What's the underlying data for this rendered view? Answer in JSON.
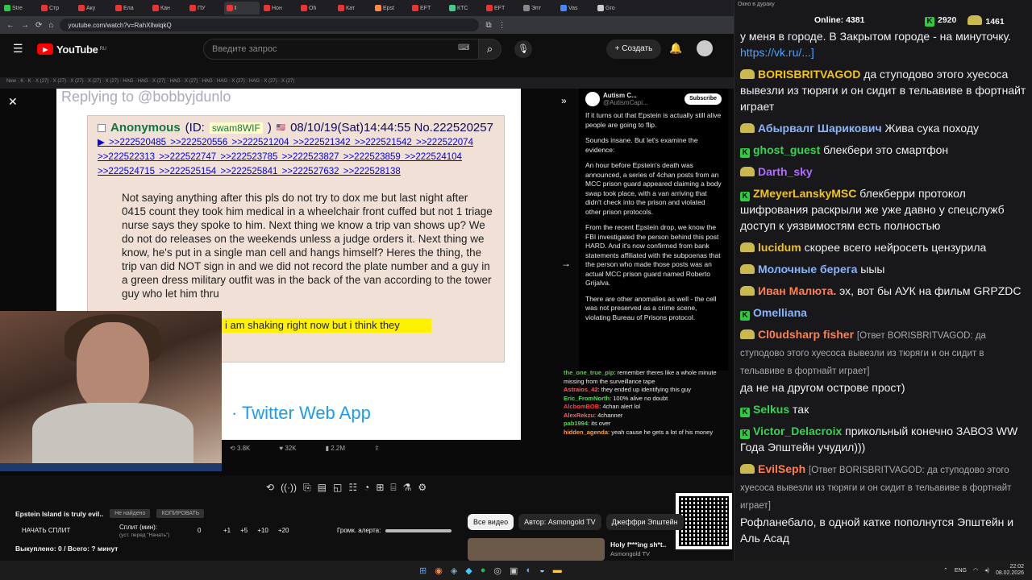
{
  "browser": {
    "tabs": [
      "Stre",
      "Стр",
      "Аку",
      "Ела",
      "Кан",
      "ПУ",
      "I",
      "Нон",
      "Оh",
      "Кат",
      "Epst",
      "EFT",
      "КТС",
      "EFT",
      "Эпт",
      "Vas",
      "Gro"
    ],
    "url": "youtube.com/watch?v=RahXIlwiqkQ",
    "window_controls": [
      "—",
      "▢",
      "✕"
    ]
  },
  "youtube": {
    "logo": "YouTube",
    "region": "RU",
    "search_placeholder": "Введите запрос",
    "create_label": "Создать",
    "chips": [
      "Все видео",
      "Автор: Asmongold TV",
      "Джеффри Эпштейн"
    ],
    "recommended": {
      "title": "Holy f***ing sh*t..",
      "channel": "Asmongold TV"
    }
  },
  "video": {
    "inner_tabs": "New · K · K · Х (27) · Х (27) · Х (27) · Х (27) · Х (27) · HAG · HAG · Х (27) · HAG · Х (27) · HAG · HAG · Х (27) · HAG · Х (27) · Х (27)",
    "tweet_heading": "Replying to @bobbyjdunlo",
    "chan_post": {
      "name": "Anonymous",
      "id_label": "(ID:",
      "id": "swam8WIF",
      "id_close": ")",
      "datetime": "08/10/19(Sat)14:44:55 No.222520257",
      "replies_1": "▶ >>222520485 >>222520556 >>222521204 >>222521342 >>222521542 >>222522074",
      "replies_2": ">>222522313 >>222522747 >>222523785 >>222523827 >>222523859 >>222524104",
      "replies_3": ">>222524715 >>222525154 >>222525841 >>222527632 >>222528138",
      "body": "Not saying anything after this pls do not try to dox me but last night after 0415 count they took him medical in a wheelchair front cuffed but not 1 triage nurse says they spoke to him. Next thing we know a trip van shows up? We do not do releases on the weekends unless a judge orders it. Next thing we know, he's put in a single man cell and hangs himself? Heres the thing, the trip van did NOT sign in and we did not record the plate number and a guy in a green dress military outfit was in the back of the van according to the tower guy who let him thru",
      "highlight": "i am shaking right now but i think they"
    },
    "twitter_app": "Twitter Web App",
    "tweet_stats": [
      "3.8K",
      "32K",
      "2.2M"
    ],
    "side": {
      "account": "Autism C...",
      "handle": "@AutismCapi...",
      "subscribe": "Subscribe",
      "paragraphs": [
        "If it turns out that Epstein is actually still alive people are going to flip.",
        "Sounds insane. But let's examine the evidence:",
        "An hour before Epstein's death was announced, a series of 4chan posts from an MCC prison guard appeared claiming a body swap took place, with a van arriving that didn't check into the prison and violated other prison protocols.",
        "From the recent Epstein drop, we know the FBI investigated the person behind this post HARD. And it's now confirmed from bank statements affiliated with the subpoenas that the person who made those posts was an actual MCC prison guard named Roberto Grijalva.",
        "There are other anomalies as well - the cell was not preserved as a crime scene, violating Bureau of Prisons protocol."
      ]
    },
    "overlay_chat": [
      {
        "name": "the_one_true_pip",
        "color": "#6bbf59",
        "text": "remember theres like a whole minute missing from the surveillance tape"
      },
      {
        "name": "Astraios_42",
        "color": "#ff5a5a",
        "text": "they ended up identifying this guy"
      },
      {
        "name": "Eric_FromNorth",
        "color": "#5ad35a",
        "text": "100% alive no doubt"
      },
      {
        "name": "AlcbomBOB",
        "color": "#ff4040",
        "text": "4chan alert lol"
      },
      {
        "name": "AlexRekzu",
        "color": "#ff6060",
        "text": "4channer"
      },
      {
        "name": "pab1994",
        "color": "#5ad35a",
        "text": "its over"
      },
      {
        "name": "hidden_agenda",
        "color": "#ff9f40",
        "text": "yeah cause he gets a lot of his money"
      }
    ]
  },
  "splits": {
    "title": "Epstein Island is truly evil..",
    "not_found": "Не найдено",
    "copy": "КОПИРОВАТЬ",
    "start": "НАЧАТЬ СПЛИТ",
    "split_label": "Сплит (мин):",
    "split_hint": "(уст. перед \"Начать\")",
    "split_value": "0",
    "increments": [
      "+1",
      "+5",
      "+10",
      "+20"
    ],
    "volume_label": "Громк. алерта:",
    "bought": "Выкуплено: 0 / Всего: ? минут"
  },
  "stream_chat": {
    "title": "Окно в дураку",
    "online_label": "Online:",
    "online_count": "4381",
    "points_green": "2920",
    "points_gold": "1461",
    "messages": [
      {
        "name": "",
        "color": "#efeff1",
        "text": "у меня в городе. В Закрытом городе - на минуточку.",
        "link": "https://vk.ru/...]"
      },
      {
        "name": "BORISBRITVAGOD",
        "color": "#f0c419",
        "text": "да ступодово этого хуесоса вывезли из тюряги и он сидит в тельавиве в фортнайт играет"
      },
      {
        "name": "Абырвалг Шарикович",
        "color": "#8ab4f8",
        "text": "Жива сука походу"
      },
      {
        "name": "ghost_guest",
        "color": "#39d353",
        "text": "блекбери это смартфон"
      },
      {
        "name": "Darth_sky",
        "color": "#b26bff",
        "text": ""
      },
      {
        "name": "ZMeyerLanskyMSC",
        "color": "#f0c419",
        "text": "блекберри протокол шифрования раскрыли же уже давно у спецслужб доступ к уязвимостям есть полностью"
      },
      {
        "name": "lucidum",
        "color": "#f0c419",
        "text": "скорее всего нейросеть цензурила"
      },
      {
        "name": "Молочные берега",
        "color": "#8ab4f8",
        "text": "ыыы"
      },
      {
        "name": "Иван Малюта.",
        "color": "#ff7f50",
        "text": "эх, вот бы АУК на фильм GRPZDC"
      },
      {
        "name": "Omelliana",
        "color": "#8ab4f8",
        "text": ""
      },
      {
        "name": "Cl0udsharp fisher",
        "color": "#ff7f50",
        "reply": "[Ответ BORISBRITVAGOD: да ступодово этого хуесоса вывезли из тюряги и он сидит в тельавиве в фортнайт играет]",
        "text": "да не на другом острове прост)"
      },
      {
        "name": "Selkus",
        "color": "#39d353",
        "text": "так"
      },
      {
        "name": "Victor_Delacroix",
        "color": "#39d353",
        "text": "прикольный конечно ЗАВОЗ WW Года Эпштейн учудил)))"
      },
      {
        "name": "EvilSeph",
        "color": "#ff7f50",
        "reply": "[Ответ BORISBRITVAGOD: да ступодово этого хуесоса вывезли из тюряги и он сидит в тельавиве в фортнайт играет]",
        "text": "Рофланебало, в одной катке пополнутся Эпштейн и Аль Асад"
      }
    ]
  },
  "taskbar": {
    "lang": "ENG",
    "time": "22:02",
    "date": "08.02.2026"
  },
  "colors": {
    "yt_red": "#ff0000",
    "chan_bg": "#f0e0d6",
    "twitter_blue": "#1d9bf0",
    "chat_bg": "#18181b"
  }
}
